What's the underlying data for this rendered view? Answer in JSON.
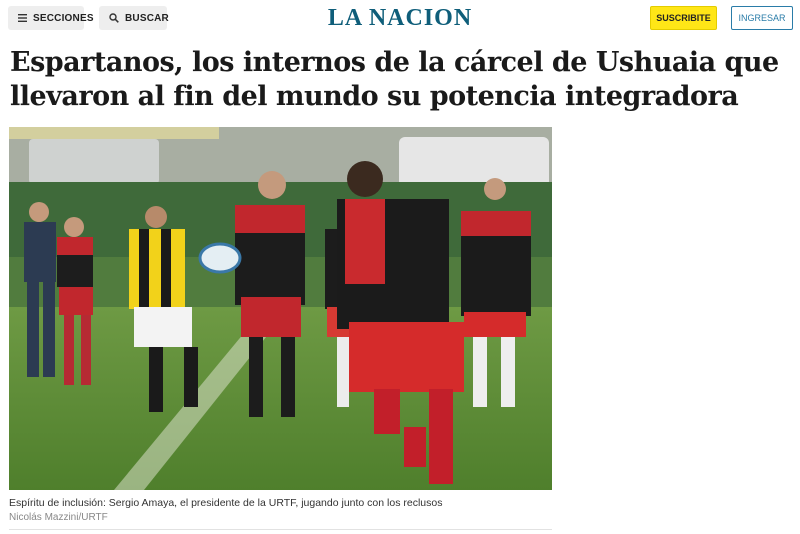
{
  "header": {
    "sections_label": "SECCIONES",
    "search_label": "BUSCAR",
    "logo_text": "LA NACION",
    "subscribe_label": "SUSCRIBITE",
    "login_label": "INGRESAR"
  },
  "article": {
    "title": "Espartanos, los internos de la cárcel de Ushuaia que llevaron al fin del mundo su potencia integradora",
    "caption": "Espíritu de inclusión: Sergio Amaya, el presidente de la URTF, jugando junto con los reclusos",
    "credit": "Nicolás Mazzini/URTF"
  },
  "colors": {
    "brand": "#0f5e7a",
    "subscribe_bg": "#ffe617",
    "login_accent": "#2a7ca8"
  },
  "icons": {
    "sections": "hamburger-icon",
    "search": "search-icon"
  }
}
